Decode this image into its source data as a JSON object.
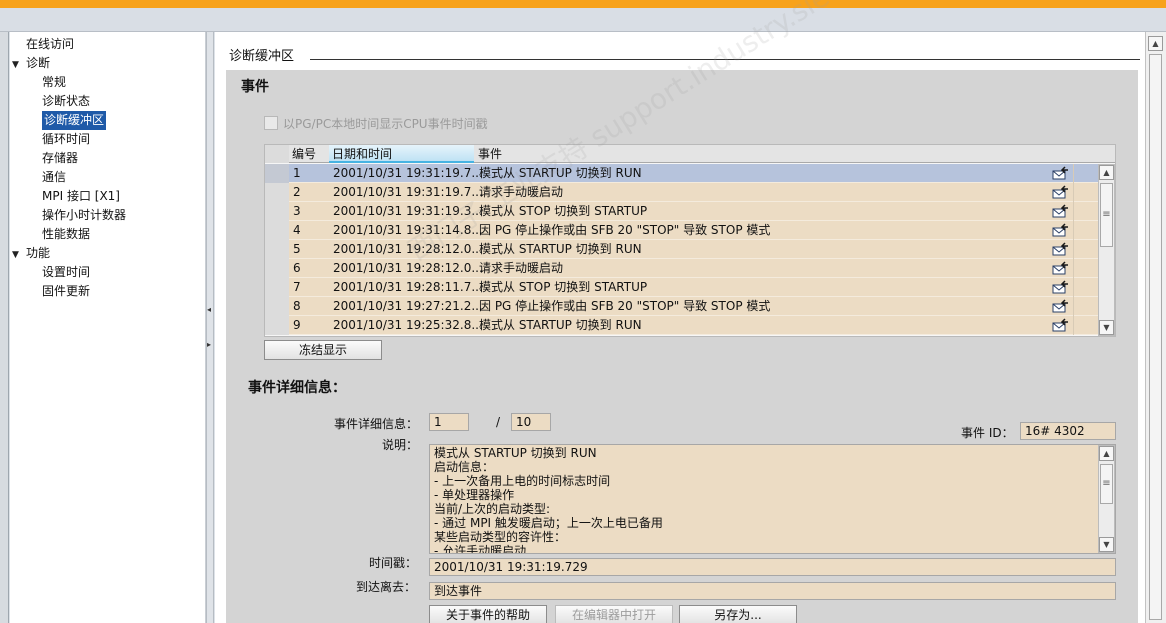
{
  "tree": {
    "items": [
      {
        "label": "在线访问",
        "indent": 0,
        "toggle": ""
      },
      {
        "label": "诊断",
        "indent": 0,
        "toggle": "▼"
      },
      {
        "label": "常规",
        "indent": 1,
        "toggle": ""
      },
      {
        "label": "诊断状态",
        "indent": 1,
        "toggle": ""
      },
      {
        "label": "诊断缓冲区",
        "indent": 1,
        "toggle": "",
        "selected": true
      },
      {
        "label": "循环时间",
        "indent": 1,
        "toggle": ""
      },
      {
        "label": "存储器",
        "indent": 1,
        "toggle": ""
      },
      {
        "label": "通信",
        "indent": 1,
        "toggle": ""
      },
      {
        "label": "MPI 接口 [X1]",
        "indent": 1,
        "toggle": ""
      },
      {
        "label": "操作小时计数器",
        "indent": 1,
        "toggle": ""
      },
      {
        "label": "性能数据",
        "indent": 1,
        "toggle": ""
      },
      {
        "label": "功能",
        "indent": 0,
        "toggle": "▼"
      },
      {
        "label": "设置时间",
        "indent": 1,
        "toggle": ""
      },
      {
        "label": "固件更新",
        "indent": 1,
        "toggle": ""
      }
    ]
  },
  "main": {
    "section_title": "诊断缓冲区",
    "events_heading": "事件",
    "checkbox_label": "以PG/PC本地时间显示CPU事件时间戳",
    "checkbox_checked": false,
    "table": {
      "columns": [
        "编号",
        "日期和时间",
        "事件"
      ],
      "rows": [
        {
          "no": "1",
          "datetime": "2001/10/31 19:31:19.7...",
          "event": "模式从 STARTUP 切换到 RUN",
          "selected": true
        },
        {
          "no": "2",
          "datetime": "2001/10/31 19:31:19.7...",
          "event": "请求手动暖启动"
        },
        {
          "no": "3",
          "datetime": "2001/10/31 19:31:19.3...",
          "event": "模式从 STOP 切换到 STARTUP"
        },
        {
          "no": "4",
          "datetime": "2001/10/31 19:31:14.8...",
          "event": "因 PG 停止操作或由 SFB 20 \"STOP\" 导致 STOP 模式"
        },
        {
          "no": "5",
          "datetime": "2001/10/31 19:28:12.0...",
          "event": "模式从 STARTUP 切换到 RUN"
        },
        {
          "no": "6",
          "datetime": "2001/10/31 19:28:12.0...",
          "event": "请求手动暖启动"
        },
        {
          "no": "7",
          "datetime": "2001/10/31 19:28:11.7...",
          "event": "模式从 STOP 切换到 STARTUP"
        },
        {
          "no": "8",
          "datetime": "2001/10/31 19:27:21.2...",
          "event": "因 PG 停止操作或由 SFB 20 \"STOP\" 导致 STOP 模式"
        },
        {
          "no": "9",
          "datetime": "2001/10/31 19:25:32.8...",
          "event": "模式从 STARTUP 切换到 RUN"
        }
      ]
    },
    "freeze_button": "冻结显示",
    "detail_heading": "事件详细信息：",
    "detail": {
      "counter_label": "事件详细信息：",
      "counter_current": "1",
      "counter_sep": "/",
      "counter_total": "10",
      "event_id_label": "事件 ID：",
      "event_id": "16# 4302",
      "desc_label": "说明：",
      "desc_lines": [
        "模式从 STARTUP 切换到 RUN",
        "启动信息：",
        "- 上一次备用上电的时间标志时间",
        "- 单处理器操作",
        "当前/上次的启动类型:",
        "- 通过 MPI 触发暖启动；上一次上电已备用",
        "某些启动类型的容许性：",
        "- 允许手动暖启动"
      ],
      "timestamp_label": "时间戳：",
      "timestamp": "2001/10/31 19:31:19.729",
      "arrival_label": "到达离去：",
      "arrival": "到达事件"
    },
    "buttons": {
      "help": "关于事件的帮助",
      "open_editor": "在编辑器中打开",
      "save_as": "另存为..."
    }
  },
  "watermark": "西门子 工业支持 support.industry.siemens.com/cs",
  "colors": {
    "accent": "#f7a21b",
    "selection": "#1f5aa8",
    "row_bg": "#ecdcc4",
    "row_selected": "#b6c3dc"
  }
}
